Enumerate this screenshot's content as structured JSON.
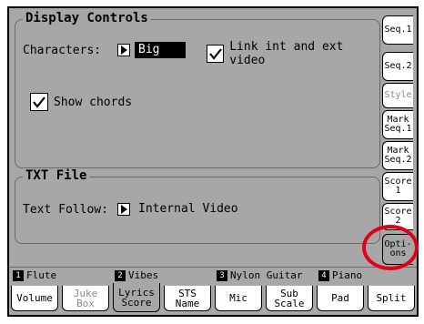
{
  "display_controls": {
    "title": "Display Controls",
    "characters_label": "Characters:",
    "characters_value": "Big",
    "link_video_label": "Link int and ext video",
    "link_video_checked": true,
    "show_chords_label": "Show chords",
    "show_chords_checked": true
  },
  "txt_file": {
    "title": "TXT File",
    "text_follow_label": "Text Follow:",
    "text_follow_value": "Internal Video"
  },
  "side_tabs": [
    {
      "label": "Seq.1"
    },
    {
      "label": "Seq.2"
    },
    {
      "label": "Style"
    },
    {
      "label": "Mark Seq.1"
    },
    {
      "label": "Mark Seq.2"
    },
    {
      "label": "Score 1"
    },
    {
      "label": "Score 2"
    },
    {
      "label": "Opti- ons"
    }
  ],
  "tracks": [
    {
      "number": "1",
      "name": "Flute"
    },
    {
      "number": "2",
      "name": "Vibes"
    },
    {
      "number": "3",
      "name": "Nylon Guitar"
    },
    {
      "number": "4",
      "name": "Piano"
    }
  ],
  "bottom_tabs": [
    {
      "label": "Volume"
    },
    {
      "label": "Juke Box"
    },
    {
      "label": "Lyrics Score"
    },
    {
      "label": "STS Name"
    },
    {
      "label": "Mic"
    },
    {
      "label": "Sub Scale"
    },
    {
      "label": "Pad"
    },
    {
      "label": "Split"
    }
  ],
  "colors": {
    "screen_bg": "#a7a7a7",
    "highlight": "#e0001a"
  }
}
